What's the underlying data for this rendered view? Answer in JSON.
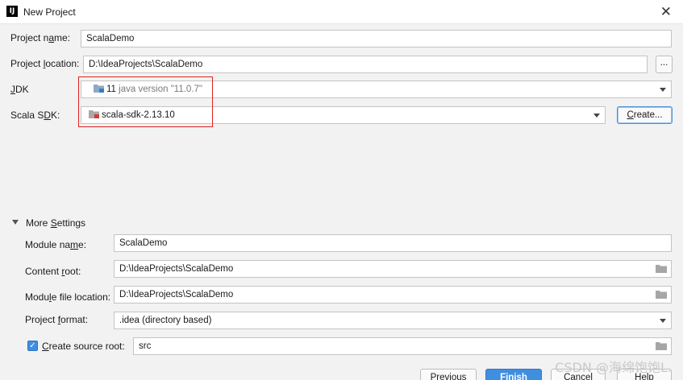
{
  "window": {
    "app_icon_text": "IJ",
    "title": "New Project",
    "close_glyph": "✕"
  },
  "form": {
    "project_name": {
      "label_pre": "Project n",
      "label_u": "a",
      "label_post": "me:",
      "value": "ScalaDemo"
    },
    "project_location": {
      "label_pre": "Project ",
      "label_u": "l",
      "label_post": "ocation:",
      "value": "D:\\IdeaProjects\\ScalaDemo",
      "browse_label": "..."
    },
    "jdk": {
      "label_u": "J",
      "label_post": "DK",
      "version": "11",
      "detail": "java version \"11.0.7\""
    },
    "scala_sdk": {
      "label_pre": "Scala S",
      "label_u": "D",
      "label_post": "K:",
      "value": "scala-sdk-2.13.10",
      "create_label_u": "C",
      "create_label_post": "reate..."
    }
  },
  "more_settings": {
    "title_pre": "More ",
    "title_u": "S",
    "title_post": "ettings",
    "module_name": {
      "label_pre": "Module na",
      "label_u": "m",
      "label_post": "e:",
      "value": "ScalaDemo"
    },
    "content_root": {
      "label_pre": "Content ",
      "label_u": "r",
      "label_post": "oot:",
      "value": "D:\\IdeaProjects\\ScalaDemo"
    },
    "module_file_location": {
      "label_pre": "Modu",
      "label_u": "l",
      "label_post": "e file location:",
      "value": "D:\\IdeaProjects\\ScalaDemo"
    },
    "project_format": {
      "label_pre": "Project ",
      "label_u": "f",
      "label_post": "ormat:",
      "value": ".idea (directory based)"
    },
    "create_source_root": {
      "label_u": "C",
      "label_post": "reate source root:",
      "value": "src",
      "checked_glyph": "✓"
    }
  },
  "footer": {
    "previous": "Previous",
    "finish": "Finish",
    "cancel": "Cancel",
    "help": "Help"
  },
  "watermark": "CSDN @海绵饱饱L.",
  "colors": {
    "accent": "#3f8ee0",
    "highlight": "#e02020",
    "background": "#f2f2f2"
  }
}
